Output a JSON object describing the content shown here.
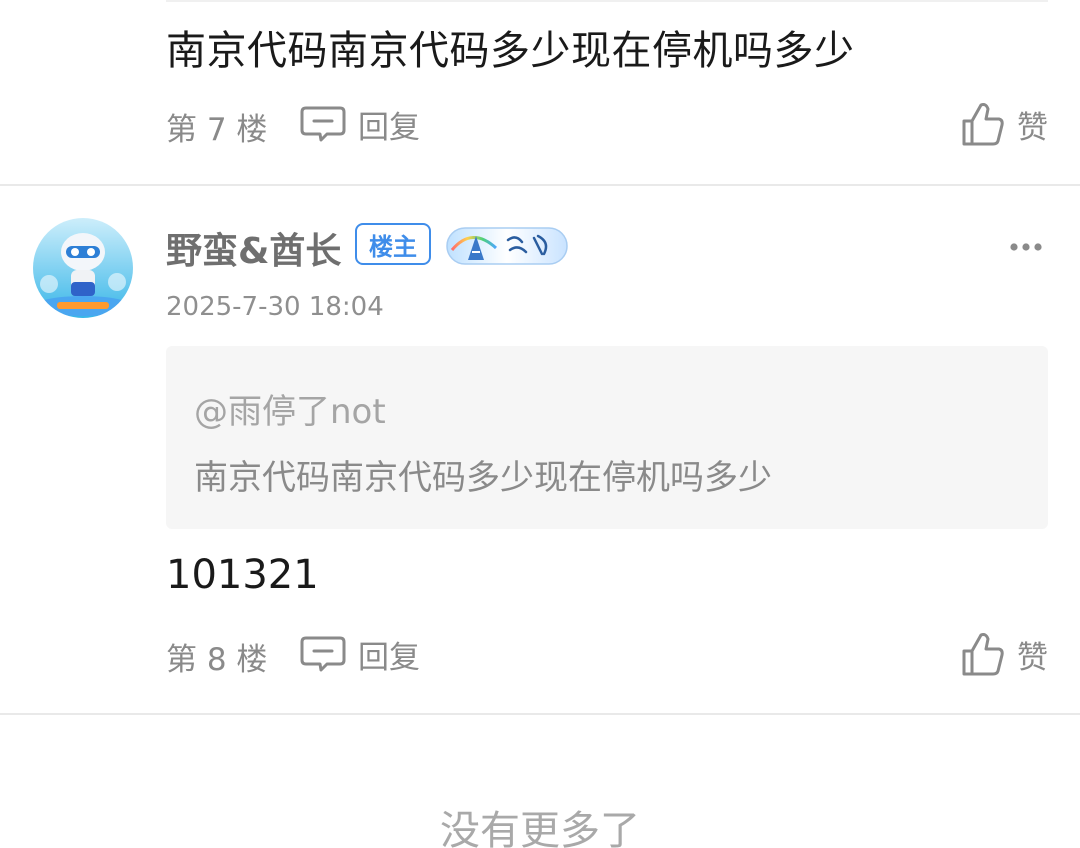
{
  "posts": [
    {
      "content": "南京代码南京代码多少现在停机吗多少",
      "floor": "第 7 楼",
      "reply_label": "回复",
      "like_label": "赞"
    },
    {
      "username": "野蛮&酋长",
      "owner_badge": "楼主",
      "level_badge_icon": "level-badge-icon",
      "time": "2025-7-30 18:04",
      "quote": {
        "mention": "@雨停了not",
        "text": "南京代码南京代码多少现在停机吗多少"
      },
      "content": "101321",
      "floor": "第 8 楼",
      "reply_label": "回复",
      "like_label": "赞"
    }
  ],
  "footer": {
    "no_more_text": "没有更多了"
  },
  "colors": {
    "accent": "#3f8dea",
    "text_primary": "#1a1a1a",
    "text_secondary": "#8a8a8a",
    "quote_bg": "#f6f6f6",
    "divider": "#e9e9e9"
  }
}
